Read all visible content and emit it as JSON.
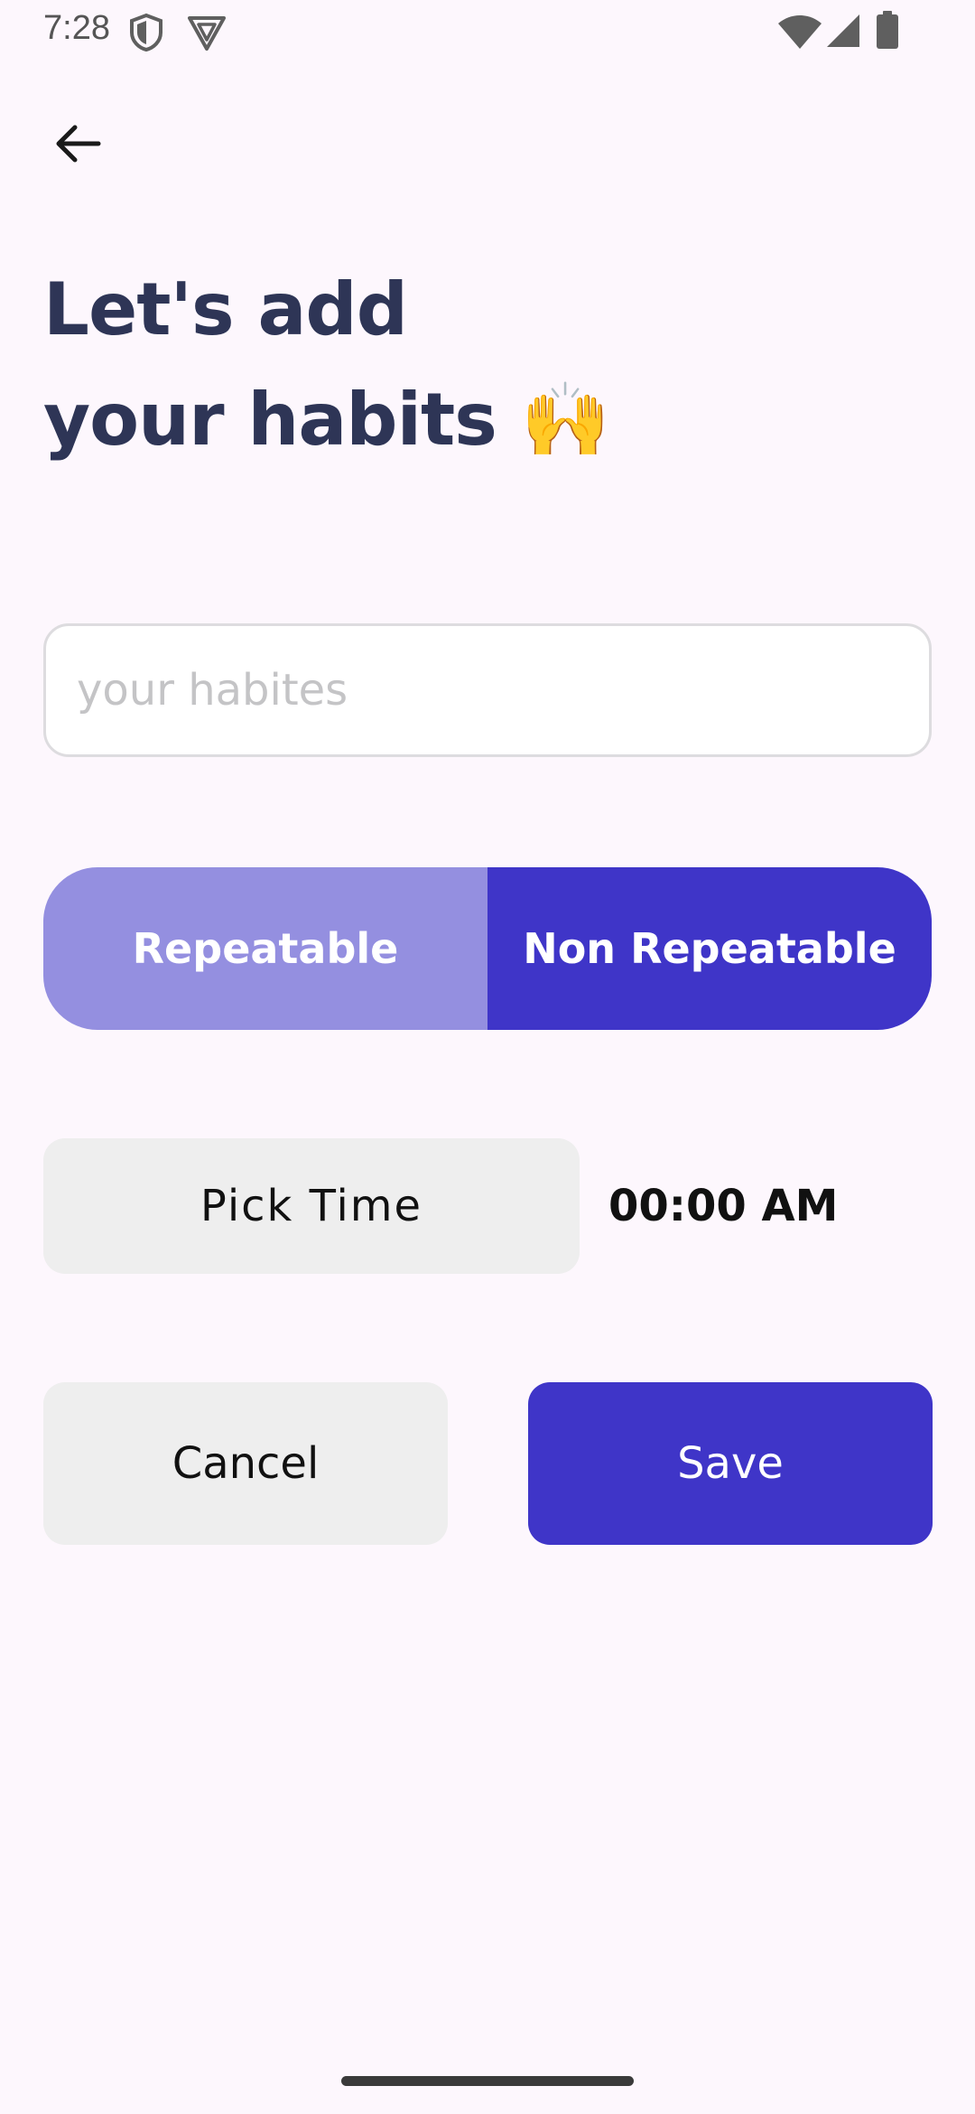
{
  "status_bar": {
    "time": "7:28",
    "icons": [
      "shield-icon",
      "vpn-icon",
      "wifi-icon",
      "cellular-signal-icon",
      "battery-icon"
    ]
  },
  "header": {
    "back_icon": "arrow-left-icon"
  },
  "title": {
    "line1": "Let's add",
    "line2": "your habits 🙌"
  },
  "habit_input": {
    "value": "",
    "placeholder": "your habites"
  },
  "habit_type_toggle": {
    "repeatable_label": "Repeatable",
    "non_repeatable_label": "Non Repeatable",
    "selected": "Non Repeatable"
  },
  "time_picker": {
    "button_label": "Pick Time",
    "value": "00:00 AM"
  },
  "actions": {
    "cancel_label": "Cancel",
    "save_label": "Save"
  },
  "colors": {
    "background": "#fdf7fd",
    "title": "#2e3556",
    "accent": "#3f35c8",
    "accent_light": "#948fe0",
    "neutral_button": "#eeeeee"
  }
}
